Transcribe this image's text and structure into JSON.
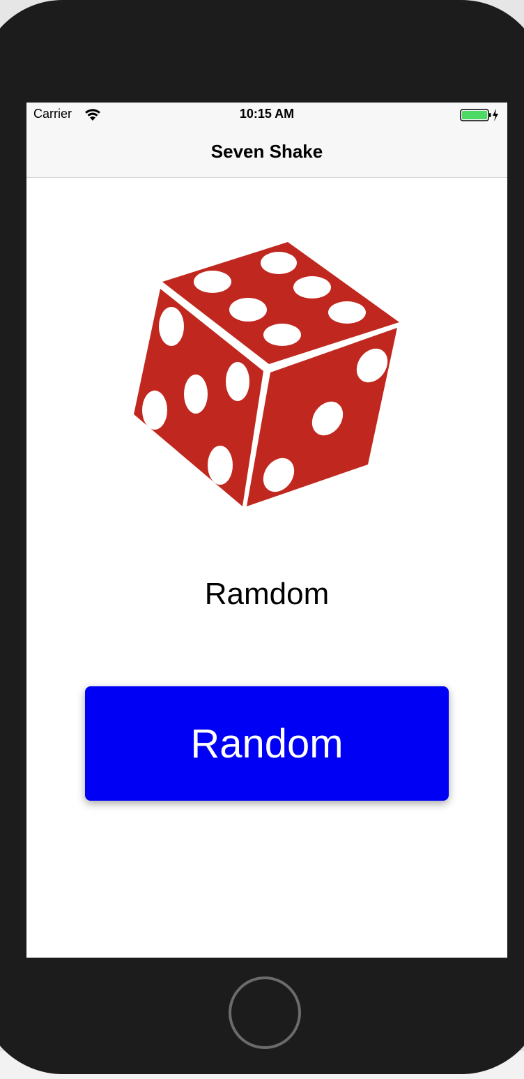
{
  "status_bar": {
    "carrier": "Carrier",
    "time": "10:15 AM",
    "wifi_icon": "wifi-icon",
    "battery_icon": "battery-charging-icon",
    "battery_color": "#4cd964"
  },
  "nav_bar": {
    "title": "Seven Shake"
  },
  "main": {
    "dice_icon": "dice-icon",
    "dice_color": "#c0281f",
    "result_text": "Ramdom",
    "button_label": "Random",
    "button_color": "#0000f5"
  },
  "device": {
    "home_button_icon": "home-button"
  }
}
